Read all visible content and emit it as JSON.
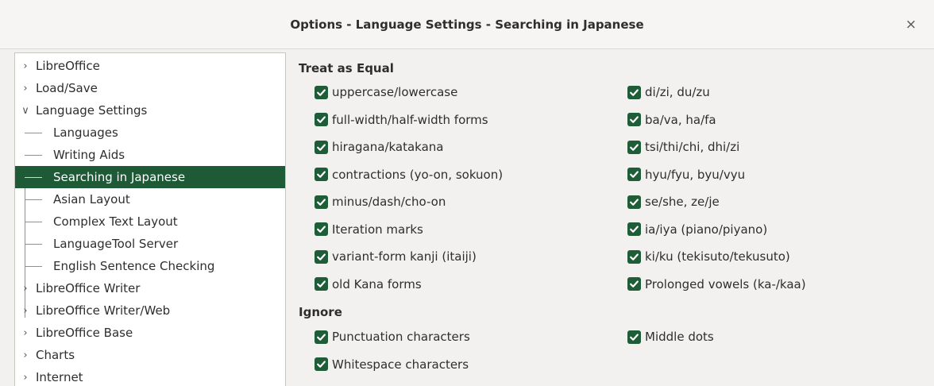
{
  "window": {
    "title": "Options - Language Settings - Searching in Japanese",
    "close_glyph": "×"
  },
  "tree": [
    {
      "label": "LibreOffice",
      "level": 0,
      "arrow": "›"
    },
    {
      "label": "Load/Save",
      "level": 0,
      "arrow": "›"
    },
    {
      "label": "Language Settings",
      "level": 0,
      "arrow": "∨"
    },
    {
      "label": "Languages",
      "level": 1
    },
    {
      "label": "Writing Aids",
      "level": 1
    },
    {
      "label": "Searching in Japanese",
      "level": 1,
      "selected": true
    },
    {
      "label": "Asian Layout",
      "level": 1
    },
    {
      "label": "Complex Text Layout",
      "level": 1
    },
    {
      "label": "LanguageTool Server",
      "level": 1
    },
    {
      "label": "English Sentence Checking",
      "level": 1
    },
    {
      "label": "LibreOffice Writer",
      "level": 0,
      "arrow": "›"
    },
    {
      "label": "LibreOffice Writer/Web",
      "level": 0,
      "arrow": "›"
    },
    {
      "label": "LibreOffice Base",
      "level": 0,
      "arrow": "›"
    },
    {
      "label": "Charts",
      "level": 0,
      "arrow": "›"
    },
    {
      "label": "Internet",
      "level": 0,
      "arrow": "›"
    }
  ],
  "treat_as_equal": {
    "title": "Treat as Equal",
    "left": [
      {
        "label": "uppercase/lowercase",
        "checked": true
      },
      {
        "label": "full-width/half-width forms",
        "checked": true
      },
      {
        "label": "hiragana/katakana",
        "checked": true
      },
      {
        "label": "contractions (yo-on, sokuon)",
        "checked": true
      },
      {
        "label": "minus/dash/cho-on",
        "checked": true
      },
      {
        "label": "Iteration marks",
        "checked": true
      },
      {
        "label": "variant-form kanji (itaiji)",
        "checked": true
      },
      {
        "label": "old Kana forms",
        "checked": true
      }
    ],
    "right": [
      {
        "label": "di/zi, du/zu",
        "checked": true
      },
      {
        "label": "ba/va, ha/fa",
        "checked": true
      },
      {
        "label": "tsi/thi/chi, dhi/zi",
        "checked": true
      },
      {
        "label": "hyu/fyu, byu/vyu",
        "checked": true
      },
      {
        "label": "se/she, ze/je",
        "checked": true
      },
      {
        "label": "ia/iya (piano/piyano)",
        "checked": true
      },
      {
        "label": "ki/ku (tekisuto/tekusuto)",
        "checked": true
      },
      {
        "label": "Prolonged vowels (ka-/kaa)",
        "checked": true
      }
    ]
  },
  "ignore": {
    "title": "Ignore",
    "left": [
      {
        "label": "Punctuation characters",
        "checked": true
      },
      {
        "label": "Whitespace characters",
        "checked": true
      }
    ],
    "right": [
      {
        "label": "Middle dots",
        "checked": true
      }
    ]
  },
  "colors": {
    "selection": "#1e5a36",
    "checkbox": "#1f5c38"
  }
}
